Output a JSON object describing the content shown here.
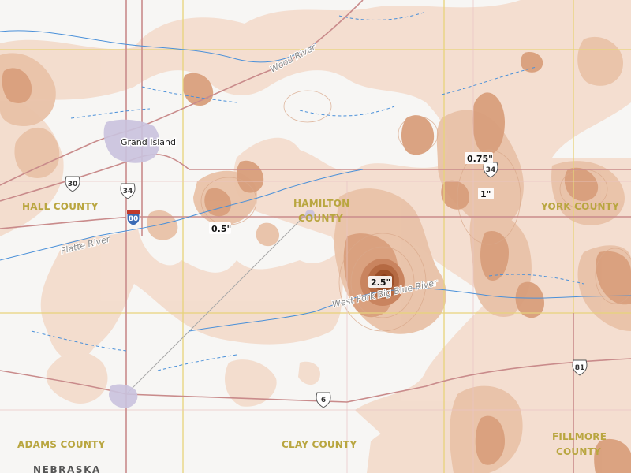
{
  "map": {
    "state_label": "NEBRASKA",
    "counties": [
      {
        "id": "hall",
        "label": "HALL COUNTY"
      },
      {
        "id": "hamilton",
        "label": "HAMILTON COUNTY",
        "lines": [
          "HAMILTON",
          "COUNTY"
        ]
      },
      {
        "id": "york",
        "label": "YORK COUNTY"
      },
      {
        "id": "adams",
        "label": "ADAMS COUNTY"
      },
      {
        "id": "clay",
        "label": "CLAY COUNTY"
      },
      {
        "id": "fillmore",
        "label": "FILLMORE COUNTY",
        "lines": [
          "FILLMORE",
          "COUNTY"
        ]
      }
    ],
    "cities": [
      {
        "id": "grand-island",
        "label": "Grand Island"
      }
    ],
    "rivers": [
      {
        "id": "wood",
        "label": "Wood River"
      },
      {
        "id": "platte",
        "label": "Platte River"
      },
      {
        "id": "west-fork-big-blue",
        "label": "West Fork Big Blue River"
      }
    ],
    "highway_shields": [
      {
        "id": "us30",
        "type": "us",
        "number": "30"
      },
      {
        "id": "us34-west",
        "type": "us",
        "number": "34"
      },
      {
        "id": "i80",
        "type": "interstate",
        "number": "80"
      },
      {
        "id": "us34-east",
        "type": "us",
        "number": "34"
      },
      {
        "id": "us6",
        "type": "us",
        "number": "6"
      },
      {
        "id": "us81",
        "type": "us",
        "number": "81"
      }
    ],
    "precip_labels": [
      {
        "id": "p-05",
        "label": "0.5\""
      },
      {
        "id": "p-075",
        "label": "0.75\""
      },
      {
        "id": "p-1",
        "label": "1\""
      },
      {
        "id": "p-25",
        "label": "2.5\""
      }
    ],
    "colors": {
      "background": "#f7f6f4",
      "precip_light": "#f2dccd",
      "precip_mid": "#e5b89d",
      "precip_dark": "#cf8f6c",
      "precip_max": "#a8542e",
      "county_line": "#e8d37a",
      "road": "#c98b8b",
      "river": "#4a90d9"
    }
  }
}
